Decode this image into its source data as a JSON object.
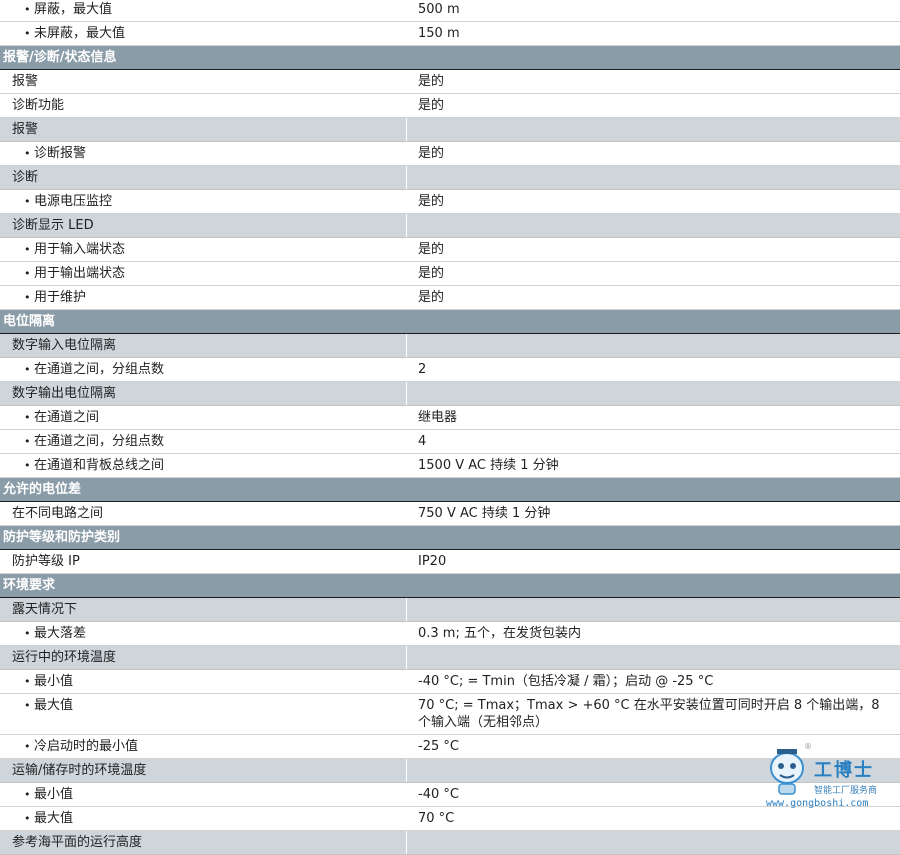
{
  "rows": [
    {
      "type": "item",
      "label": "屏蔽，最大值",
      "value": "500 m"
    },
    {
      "type": "item",
      "label": "未屏蔽，最大值",
      "value": "150 m"
    },
    {
      "type": "header",
      "label": "报警/诊断/状态信息",
      "value": ""
    },
    {
      "type": "plain",
      "label": "报警",
      "value": "是的"
    },
    {
      "type": "plain",
      "label": "诊断功能",
      "value": "是的"
    },
    {
      "type": "sub",
      "label": "报警",
      "value": ""
    },
    {
      "type": "item",
      "label": "诊断报警",
      "value": "是的"
    },
    {
      "type": "sub",
      "label": "诊断",
      "value": ""
    },
    {
      "type": "item",
      "label": "电源电压监控",
      "value": "是的"
    },
    {
      "type": "sub",
      "label": "诊断显示 LED",
      "value": ""
    },
    {
      "type": "item",
      "label": "用于输入端状态",
      "value": "是的"
    },
    {
      "type": "item",
      "label": "用于输出端状态",
      "value": "是的"
    },
    {
      "type": "item",
      "label": "用于维护",
      "value": "是的"
    },
    {
      "type": "header",
      "label": "电位隔离",
      "value": ""
    },
    {
      "type": "sub",
      "label": "数字输入电位隔离",
      "value": ""
    },
    {
      "type": "item",
      "label": "在通道之间，分组点数",
      "value": "2"
    },
    {
      "type": "sub",
      "label": "数字输出电位隔离",
      "value": ""
    },
    {
      "type": "item",
      "label": "在通道之间",
      "value": "继电器"
    },
    {
      "type": "item",
      "label": "在通道之间，分组点数",
      "value": "4"
    },
    {
      "type": "item",
      "label": "在通道和背板总线之间",
      "value": "1500 V AC 持续 1 分钟"
    },
    {
      "type": "header",
      "label": "允许的电位差",
      "value": ""
    },
    {
      "type": "plain",
      "label": "在不同电路之间",
      "value": "750 V AC 持续 1 分钟"
    },
    {
      "type": "header",
      "label": "防护等级和防护类别",
      "value": ""
    },
    {
      "type": "plain",
      "label": "防护等级 IP",
      "value": "IP20"
    },
    {
      "type": "header",
      "label": "环境要求",
      "value": ""
    },
    {
      "type": "sub",
      "label": "露天情况下",
      "value": ""
    },
    {
      "type": "item",
      "label": "最大落差",
      "value": "0.3 m; 五个，在发货包装内"
    },
    {
      "type": "sub",
      "label": "运行中的环境温度",
      "value": ""
    },
    {
      "type": "item",
      "label": "最小值",
      "value": "-40 °C; = Tmin（包括冷凝 / 霜）；启动 @ -25 °C"
    },
    {
      "type": "item",
      "label": "最大值",
      "value": "70 °C; = Tmax；Tmax > +60 °C 在水平安装位置可同时开启 8 个输出端，8 个输入端（无相邻点）"
    },
    {
      "type": "item",
      "label": "冷启动时的最小值",
      "value": "-25 °C"
    },
    {
      "type": "sub",
      "label": "运输/储存时的环境温度",
      "value": ""
    },
    {
      "type": "item",
      "label": "最小值",
      "value": "-40 °C"
    },
    {
      "type": "item",
      "label": "最大值",
      "value": "70 °C"
    },
    {
      "type": "sub",
      "label": "参考海平面的运行高度",
      "value": ""
    }
  ],
  "watermark": {
    "title": "工博士",
    "subtitle": "智能工厂服务商",
    "url": "www.gongboshi.com",
    "reg": "®"
  }
}
